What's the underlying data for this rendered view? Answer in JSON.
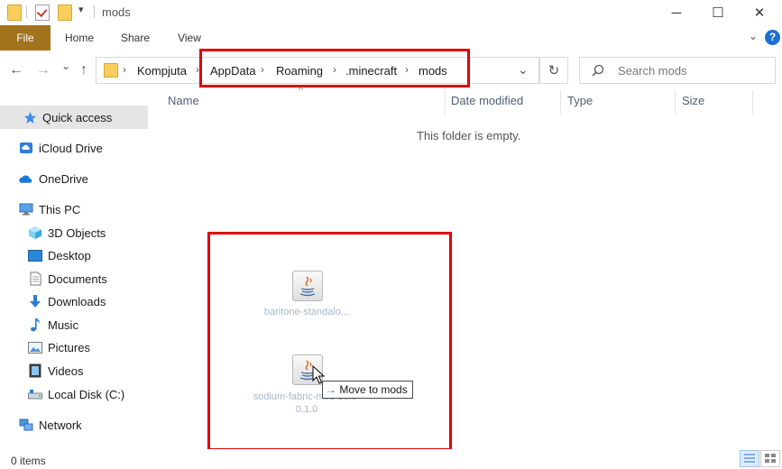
{
  "window": {
    "title": "mods",
    "minimize_glyph": "─",
    "maximize_glyph": "☐",
    "close_glyph": "✕"
  },
  "ribbon": {
    "tabs": [
      "File",
      "Home",
      "Share",
      "View"
    ],
    "help_glyph": "?"
  },
  "nav": {
    "back_glyph": "←",
    "forward_glyph": "→",
    "recent_glyph": "⌄",
    "up_glyph": "↑",
    "address_dropdown_glyph": "⌄",
    "refresh_glyph": "↻"
  },
  "breadcrumb": [
    "Kompjuta",
    "AppData",
    "Roaming",
    ".minecraft",
    "mods"
  ],
  "search": {
    "placeholder": "Search mods",
    "value": ""
  },
  "sidebar": {
    "items": [
      {
        "label": "Quick access",
        "icon": "star-icon"
      },
      {
        "label": "iCloud Drive",
        "icon": "icloud-icon"
      },
      {
        "label": "OneDrive",
        "icon": "cloud-icon"
      },
      {
        "label": "This PC",
        "icon": "computer-icon"
      },
      {
        "label": "3D Objects",
        "icon": "cube-icon"
      },
      {
        "label": "Desktop",
        "icon": "desktop-icon"
      },
      {
        "label": "Documents",
        "icon": "document-icon"
      },
      {
        "label": "Downloads",
        "icon": "download-icon"
      },
      {
        "label": "Music",
        "icon": "music-icon"
      },
      {
        "label": "Pictures",
        "icon": "picture-icon"
      },
      {
        "label": "Videos",
        "icon": "video-icon"
      },
      {
        "label": "Local Disk (C:)",
        "icon": "disk-icon"
      },
      {
        "label": "Network",
        "icon": "network-icon"
      }
    ]
  },
  "columns": [
    "Name",
    "Date modified",
    "Type",
    "Size"
  ],
  "sort_glyph": "^",
  "empty_message": "This folder is empty.",
  "drag": {
    "files": [
      "baritone-standalo...",
      "sodium-fabric-mc1 16.3-0.1.0"
    ],
    "tooltip": "Move to mods",
    "tooltip_glyph": "→"
  },
  "status": {
    "items_count": "0 items"
  },
  "colors": {
    "highlight_box": "#e00000",
    "file_tab": "#a1731d",
    "selection": "#cce8ff",
    "folder": "#f8cf5e"
  }
}
